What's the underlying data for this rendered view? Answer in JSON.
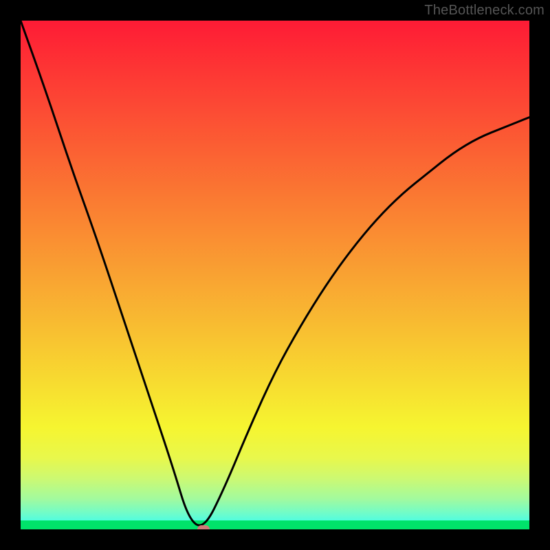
{
  "watermark": "TheBottleneck.com",
  "chart_data": {
    "type": "line",
    "title": "",
    "xlabel": "",
    "ylabel": "",
    "xlim": [
      0,
      1
    ],
    "ylim": [
      0,
      100
    ],
    "grid": false,
    "background": "heatmap-gradient-red-to-green",
    "series": [
      {
        "name": "bottleneck-curve",
        "color": "#000000",
        "x": [
          0.0,
          0.05,
          0.1,
          0.15,
          0.2,
          0.25,
          0.3,
          0.33,
          0.36,
          0.4,
          0.45,
          0.5,
          0.55,
          0.6,
          0.65,
          0.7,
          0.75,
          0.8,
          0.85,
          0.9,
          0.95,
          1.0
        ],
        "values": [
          100,
          86,
          71,
          57,
          42,
          27,
          12,
          2,
          0,
          8,
          20,
          31,
          40,
          48,
          55,
          61,
          66,
          70,
          74,
          77,
          79,
          81
        ]
      }
    ],
    "marker": {
      "x": 0.36,
      "y": 0,
      "color": "#cf7a78"
    },
    "gradient_stops": [
      {
        "offset": 0.0,
        "color": "#fe1b35"
      },
      {
        "offset": 0.12,
        "color": "#fd3c34"
      },
      {
        "offset": 0.25,
        "color": "#fb5f33"
      },
      {
        "offset": 0.38,
        "color": "#fa8232"
      },
      {
        "offset": 0.5,
        "color": "#f9a232"
      },
      {
        "offset": 0.62,
        "color": "#f8c231"
      },
      {
        "offset": 0.72,
        "color": "#f7de30"
      },
      {
        "offset": 0.8,
        "color": "#f6f530"
      },
      {
        "offset": 0.86,
        "color": "#e8f84c"
      },
      {
        "offset": 0.9,
        "color": "#ccf972"
      },
      {
        "offset": 0.94,
        "color": "#a2fa9e"
      },
      {
        "offset": 0.97,
        "color": "#6cfccc"
      },
      {
        "offset": 1.0,
        "color": "#2efef8"
      }
    ],
    "greenband_top_color": "#00e36a"
  }
}
